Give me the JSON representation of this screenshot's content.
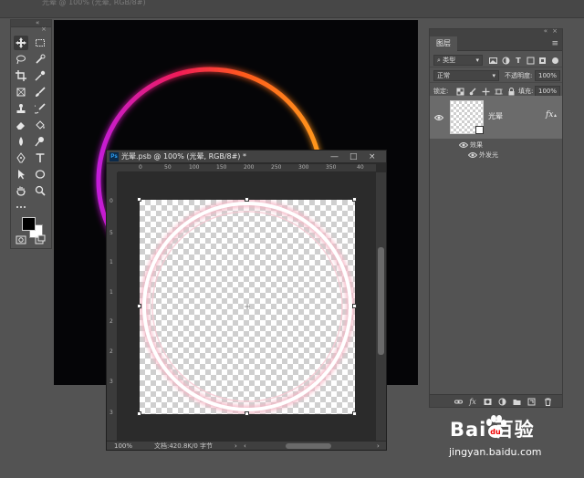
{
  "topbar": {
    "document_tab_title": "光晕 @ 100% (光晕, RGB/8#)"
  },
  "colors": {
    "app_bg": "#535353",
    "ring_gradient": [
      "#c31fd9",
      "#f01a5a",
      "#ff5a1e",
      "#ff9a1a"
    ],
    "selected_layer": "#6b6b6b"
  },
  "toolbar": {
    "collapse_glyph": "«",
    "close_glyph": "×",
    "tools": [
      "move-icon",
      "marquee-icon",
      "lasso-icon",
      "quick-select-icon",
      "crop-icon",
      "eyedropper-icon",
      "frame-icon",
      "brush-icon",
      "stamp-icon",
      "history-brush-icon",
      "eraser-icon",
      "fill-icon",
      "blur-icon",
      "dodge-icon",
      "pen-icon",
      "type-icon",
      "path-select-icon",
      "ellipse-icon",
      "hand-icon",
      "zoom-icon",
      "more-icon",
      "quick-mask-icon",
      "screen-mode-icon"
    ]
  },
  "document": {
    "title": "光晕.psb @ 100% (光晕, RGB/8#) *",
    "minimize": "—",
    "maximize": "□",
    "close": "×",
    "ruler_h": [
      "0",
      "50",
      "100",
      "150",
      "200",
      "250",
      "300",
      "350",
      "40"
    ],
    "ruler_v": [
      "0",
      "5",
      "1",
      "1",
      "2",
      "2",
      "3",
      "3"
    ],
    "zoom": "100%",
    "status": "文档:420.8K/0 字节",
    "status_arrow": "›",
    "scroll_left": "‹",
    "scroll_right": "›"
  },
  "layers_panel": {
    "tab": "图层",
    "menu_glyph": "≡",
    "collapse_glyph": "«",
    "close_glyph": "×",
    "filter_select": "类型",
    "blend_mode": "正常",
    "opacity_label": "不透明度:",
    "opacity_value": "100%",
    "lock_label": "锁定:",
    "fill_label": "填充:",
    "fill_value": "100%",
    "layer": {
      "name": "光晕",
      "fx": "fx",
      "effects_label": "效果",
      "effect_name": "外发光"
    }
  },
  "watermark": {
    "logo": "Bai  百验",
    "url": "jingyan.baidu.com"
  }
}
